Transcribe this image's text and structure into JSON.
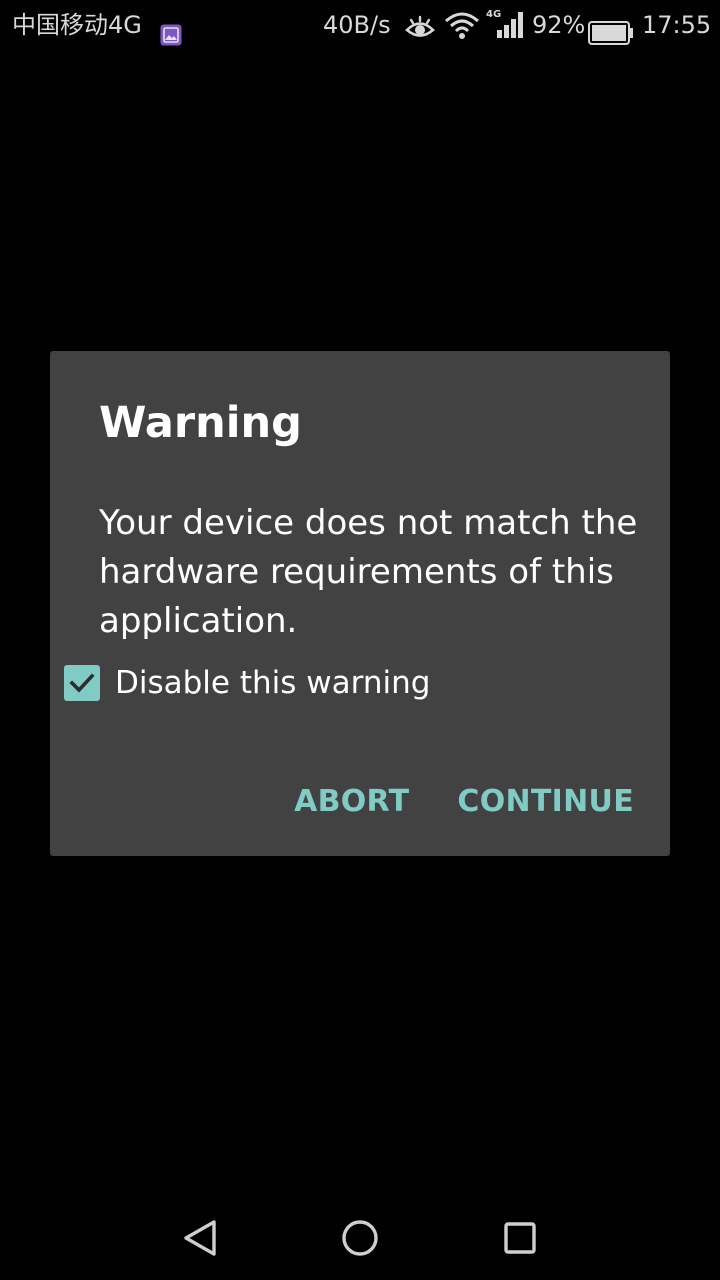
{
  "status_bar": {
    "carrier": "中国移动4G",
    "network_speed": "40B/s",
    "network_type": "4G",
    "battery_percent": "92%",
    "time": "17:55",
    "icons": [
      "gallery-icon",
      "eye-icon",
      "wifi-icon",
      "cellular-signal-icon",
      "battery-icon"
    ]
  },
  "dialog": {
    "title": "Warning",
    "message": "Your device does not match the hardware requirements of this application.",
    "checkbox": {
      "label": "Disable this warning",
      "checked": true
    },
    "buttons": {
      "abort": "ABORT",
      "continue": "CONTINUE"
    },
    "colors": {
      "background": "#424242",
      "accent": "#80cbc4",
      "text": "#ffffff"
    }
  },
  "nav_bar": {
    "icons": [
      "back-icon",
      "home-icon",
      "recent-apps-icon"
    ]
  }
}
